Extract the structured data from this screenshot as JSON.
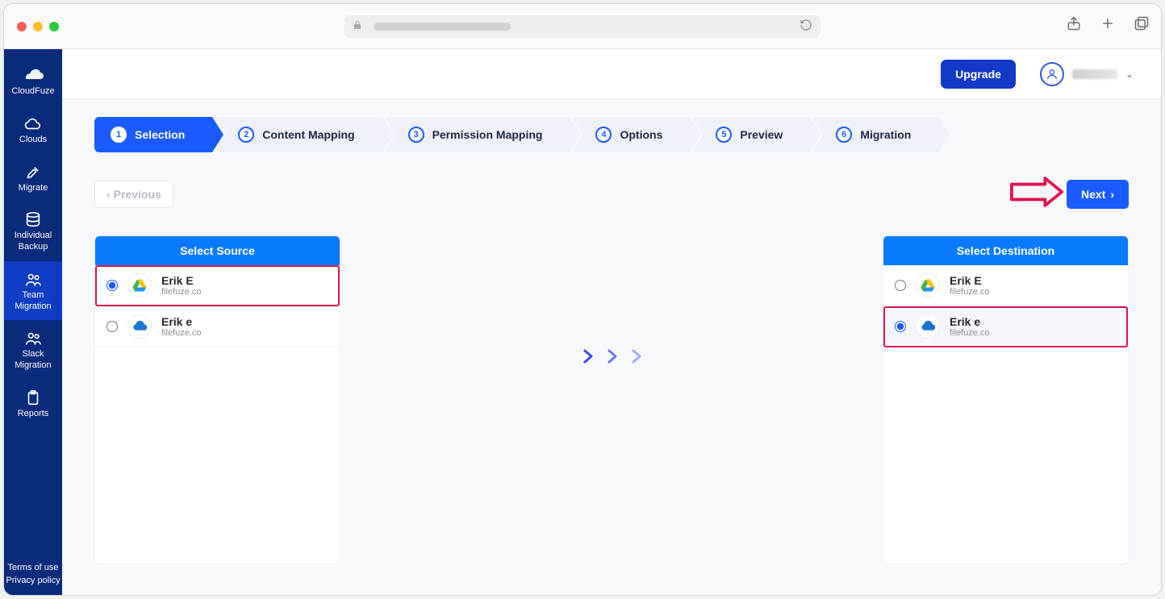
{
  "sidebar": {
    "brand": "CloudFuze",
    "items": [
      {
        "label": "Clouds",
        "icon": "cloud"
      },
      {
        "label": "Migrate",
        "icon": "rocket"
      },
      {
        "label": "Individual Backup",
        "icon": "db"
      },
      {
        "label": "Team Migration",
        "icon": "users",
        "active": true
      },
      {
        "label": "Slack Migration",
        "icon": "users"
      },
      {
        "label": "Reports",
        "icon": "clipboard"
      }
    ],
    "footer": {
      "terms": "Terms of use",
      "privacy": "Privacy policy"
    }
  },
  "topbar": {
    "upgrade": "Upgrade"
  },
  "stepper": [
    {
      "num": "1",
      "label": "Selection",
      "active": true
    },
    {
      "num": "2",
      "label": "Content Mapping"
    },
    {
      "num": "3",
      "label": "Permission Mapping"
    },
    {
      "num": "4",
      "label": "Options"
    },
    {
      "num": "5",
      "label": "Preview"
    },
    {
      "num": "6",
      "label": "Migration"
    }
  ],
  "buttons": {
    "previous": "Previous",
    "next": "Next"
  },
  "source": {
    "header": "Select Source",
    "items": [
      {
        "title": "Erik E",
        "sub": "filefuze.co",
        "provider": "gdrive",
        "selected": true,
        "highlight": true
      },
      {
        "title": "Erik e",
        "sub": "filefuze.co",
        "provider": "onedrive",
        "selected": false,
        "highlight": false
      }
    ]
  },
  "destination": {
    "header": "Select Destination",
    "items": [
      {
        "title": "Erik E",
        "sub": "filefuze.co",
        "provider": "gdrive",
        "selected": false,
        "highlight": false
      },
      {
        "title": "Erik e",
        "sub": "filefuze.co",
        "provider": "onedrive",
        "selected": true,
        "highlight": true
      }
    ]
  }
}
